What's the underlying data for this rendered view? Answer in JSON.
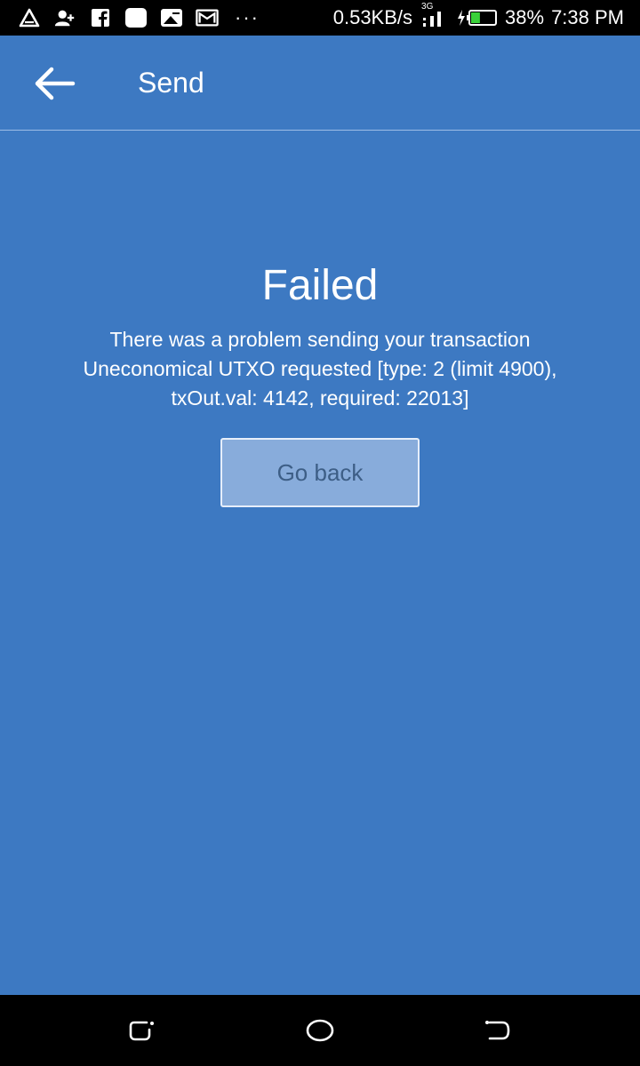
{
  "status_bar": {
    "icons": [
      "alert-triangle-icon",
      "add-person-icon",
      "facebook-icon",
      "notification-square-icon",
      "image-icon",
      "gmail-icon"
    ],
    "more": "···",
    "net_speed": "0.53KB/s",
    "network_type": "3G",
    "battery": "38%",
    "time": "7:38 PM"
  },
  "app_bar": {
    "title": "Send",
    "back_icon": "arrow-left-icon"
  },
  "result": {
    "title": "Failed",
    "message_lines": [
      "There was a problem sending your transaction",
      "Uneconomical UTXO requested [type: 2 (limit 4900),",
      "txOut.val: 4142, required: 22013]"
    ],
    "go_back_label": "Go back"
  },
  "nav_bar": {
    "buttons": [
      "recent-apps-icon",
      "home-icon",
      "back-icon"
    ]
  },
  "colors": {
    "background": "#3d79c2",
    "button_fill": "#88acdb",
    "button_text": "#3d5e86",
    "bars": "#000000"
  }
}
